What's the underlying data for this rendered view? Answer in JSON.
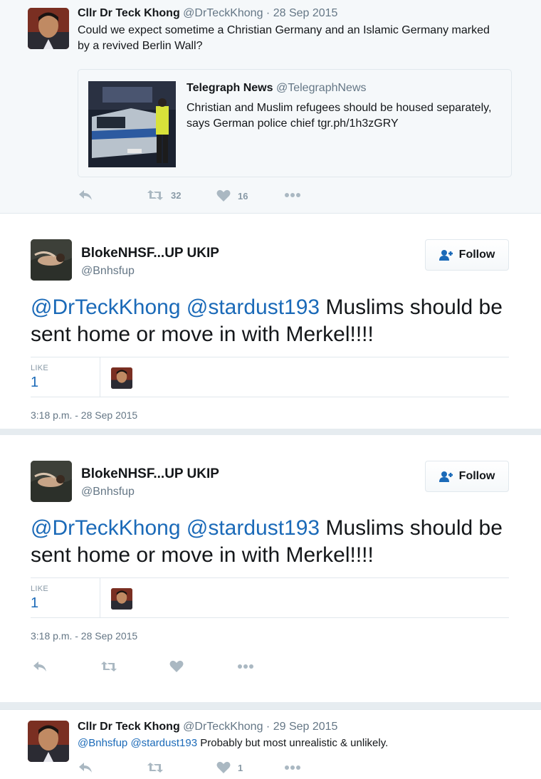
{
  "tweet1": {
    "name": "Cllr Dr Teck Khong",
    "handle": "@DrTeckKhong",
    "date": "· 28 Sep 2015",
    "text": "Could we expect sometime a Christian Germany and an Islamic Germany marked by a revived Berlin Wall?",
    "quote": {
      "name": "Telegraph News",
      "handle": "@TelegraphNews",
      "text": "Christian and Muslim refugees should be housed separately, says German police chief tgr.ph/1h3zGRY",
      "image_label": "POLIZEI"
    },
    "retweets": "32",
    "likes": "16"
  },
  "card1": {
    "name": "BlokeNHSF...UP UKIP",
    "handle": "@Bnhsfup",
    "follow_label": "Follow",
    "mention1": "@DrTeckKhong",
    "mention2": "@stardust193",
    "text": " Muslims should be sent home or move in with Merkel!!!!",
    "like_label": "LIKE",
    "like_count": "1",
    "timestamp": "3:18 p.m. - 28 Sep 2015"
  },
  "card2": {
    "name": "BlokeNHSF...UP UKIP",
    "handle": "@Bnhsfup",
    "follow_label": "Follow",
    "mention1": "@DrTeckKhong",
    "mention2": "@stardust193",
    "text": " Muslims should be sent home or move in with Merkel!!!!",
    "like_label": "LIKE",
    "like_count": "1",
    "timestamp": "3:18 p.m. - 28 Sep 2015"
  },
  "tweet2": {
    "name": "Cllr Dr Teck Khong",
    "handle": "@DrTeckKhong",
    "date": "· 29 Sep 2015",
    "mention1": "@Bnhsfup",
    "mention2": "@stardust193",
    "text": " Probably but most unrealistic & unlikely.",
    "likes": "1"
  },
  "icons": [
    "reply-icon",
    "retweet-icon",
    "heart-icon",
    "more-icon",
    "follow-person-icon"
  ],
  "colors": {
    "link": "#1b6ab8",
    "muted": "#657786",
    "background": "#f5f8fa",
    "icon": "#aab8c2"
  }
}
